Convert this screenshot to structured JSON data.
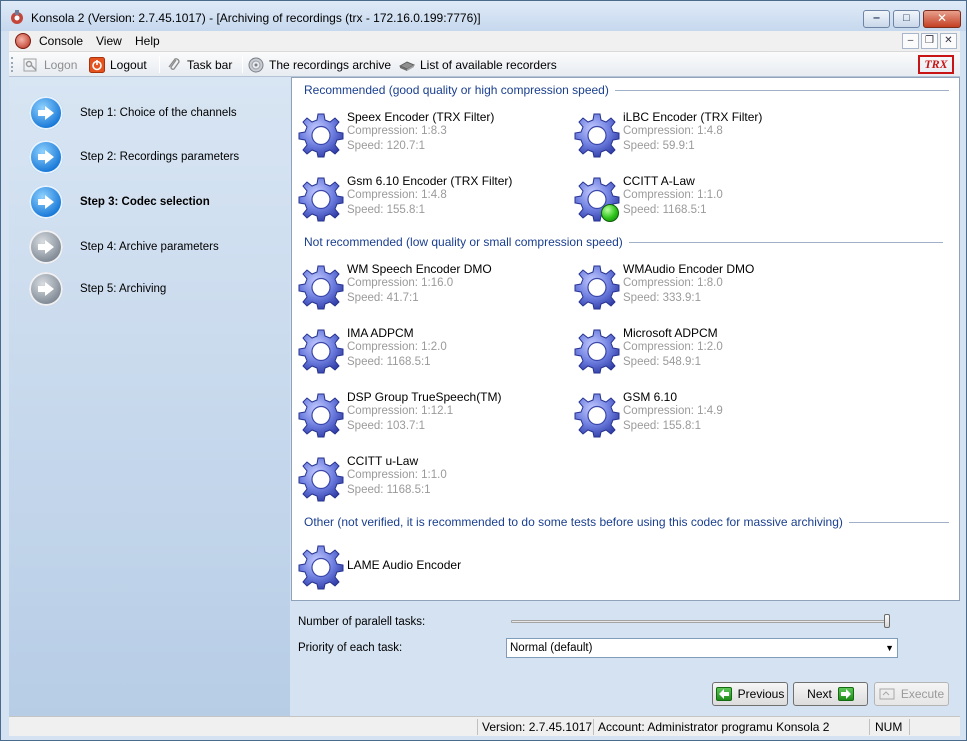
{
  "window": {
    "title": "Konsola 2 (Version:  2.7.45.1017) - [Archiving of recordings (trx - 172.16.0.199:7776)]",
    "minimize_glyph": "‒",
    "maximize_glyph": "□",
    "close_glyph": "✕"
  },
  "menu": {
    "items": [
      {
        "label": "Console"
      },
      {
        "label": "View"
      },
      {
        "label": "Help"
      }
    ],
    "mdi_minimize": "–",
    "mdi_restore": "❐",
    "mdi_close": "✕"
  },
  "toolbar": {
    "logon": "Logon",
    "logout": "Logout",
    "taskbar": "Task bar",
    "archive": "The recordings archive",
    "recorders": "List of available recorders",
    "logo": "TRX"
  },
  "steps": [
    {
      "label": "Step 1: Choice of the channels",
      "state": "done"
    },
    {
      "label": "Step 2: Recordings parameters",
      "state": "done"
    },
    {
      "label": "Step 3: Codec selection",
      "state": "current"
    },
    {
      "label": "Step 4: Archive parameters",
      "state": "pending"
    },
    {
      "label": "Step 5: Archiving",
      "state": "pending"
    }
  ],
  "groups": {
    "recommended": "Recommended (good quality or high compression speed)",
    "not_recommended": "Not recommended (low quality or small compression speed)",
    "other": "Other (not verified, it is recommended to do some tests before using this codec for massive archiving)"
  },
  "codecs": {
    "speex": {
      "name": "Speex Encoder (TRX Filter)",
      "compression": "Compression: 1:8.3",
      "speed": "Speed: 120.7:1"
    },
    "ilbc": {
      "name": "iLBC Encoder (TRX Filter)",
      "compression": "Compression: 1:4.8",
      "speed": "Speed: 59.9:1"
    },
    "gsm_trx": {
      "name": "Gsm 6.10 Encoder (TRX Filter)",
      "compression": "Compression: 1:4.8",
      "speed": "Speed: 155.8:1"
    },
    "alaw": {
      "name": "CCITT A-Law",
      "compression": "Compression: 1:1.0",
      "speed": "Speed: 1168.5:1",
      "selected": true
    },
    "wmspeech": {
      "name": "WM Speech Encoder DMO",
      "compression": "Compression: 1:16.0",
      "speed": "Speed: 41.7:1"
    },
    "wmaudio": {
      "name": "WMAudio Encoder DMO",
      "compression": "Compression: 1:8.0",
      "speed": "Speed: 333.9:1"
    },
    "ima": {
      "name": "IMA ADPCM",
      "compression": "Compression: 1:2.0",
      "speed": "Speed: 1168.5:1"
    },
    "msadpcm": {
      "name": "Microsoft ADPCM",
      "compression": "Compression: 1:2.0",
      "speed": "Speed: 548.9:1"
    },
    "truespeech": {
      "name": "DSP Group TrueSpeech(TM)",
      "compression": "Compression: 1:12.1",
      "speed": "Speed: 103.7:1"
    },
    "gsm610": {
      "name": "GSM 6.10",
      "compression": "Compression: 1:4.9",
      "speed": "Speed: 155.8:1"
    },
    "ulaw": {
      "name": "CCITT u-Law",
      "compression": "Compression: 1:1.0",
      "speed": "Speed: 1168.5:1"
    },
    "lame": {
      "name": "LAME Audio Encoder"
    }
  },
  "options": {
    "parallel_label": "Number of paralell tasks:",
    "parallel_value": 1.0,
    "priority_label": "Priority of each task:",
    "priority_value": "Normal (default)"
  },
  "buttons": {
    "previous": "Previous",
    "next": "Next",
    "execute": "Execute"
  },
  "status": {
    "version": "Version: 2.7.45.1017",
    "account": "Account: Administrator programu Konsola 2",
    "num": "NUM"
  },
  "colors": {
    "group_title": "#1a3f8f",
    "gear": "#6f7fe0",
    "selected": "#2ec31b",
    "close_button": "#c33f23"
  }
}
